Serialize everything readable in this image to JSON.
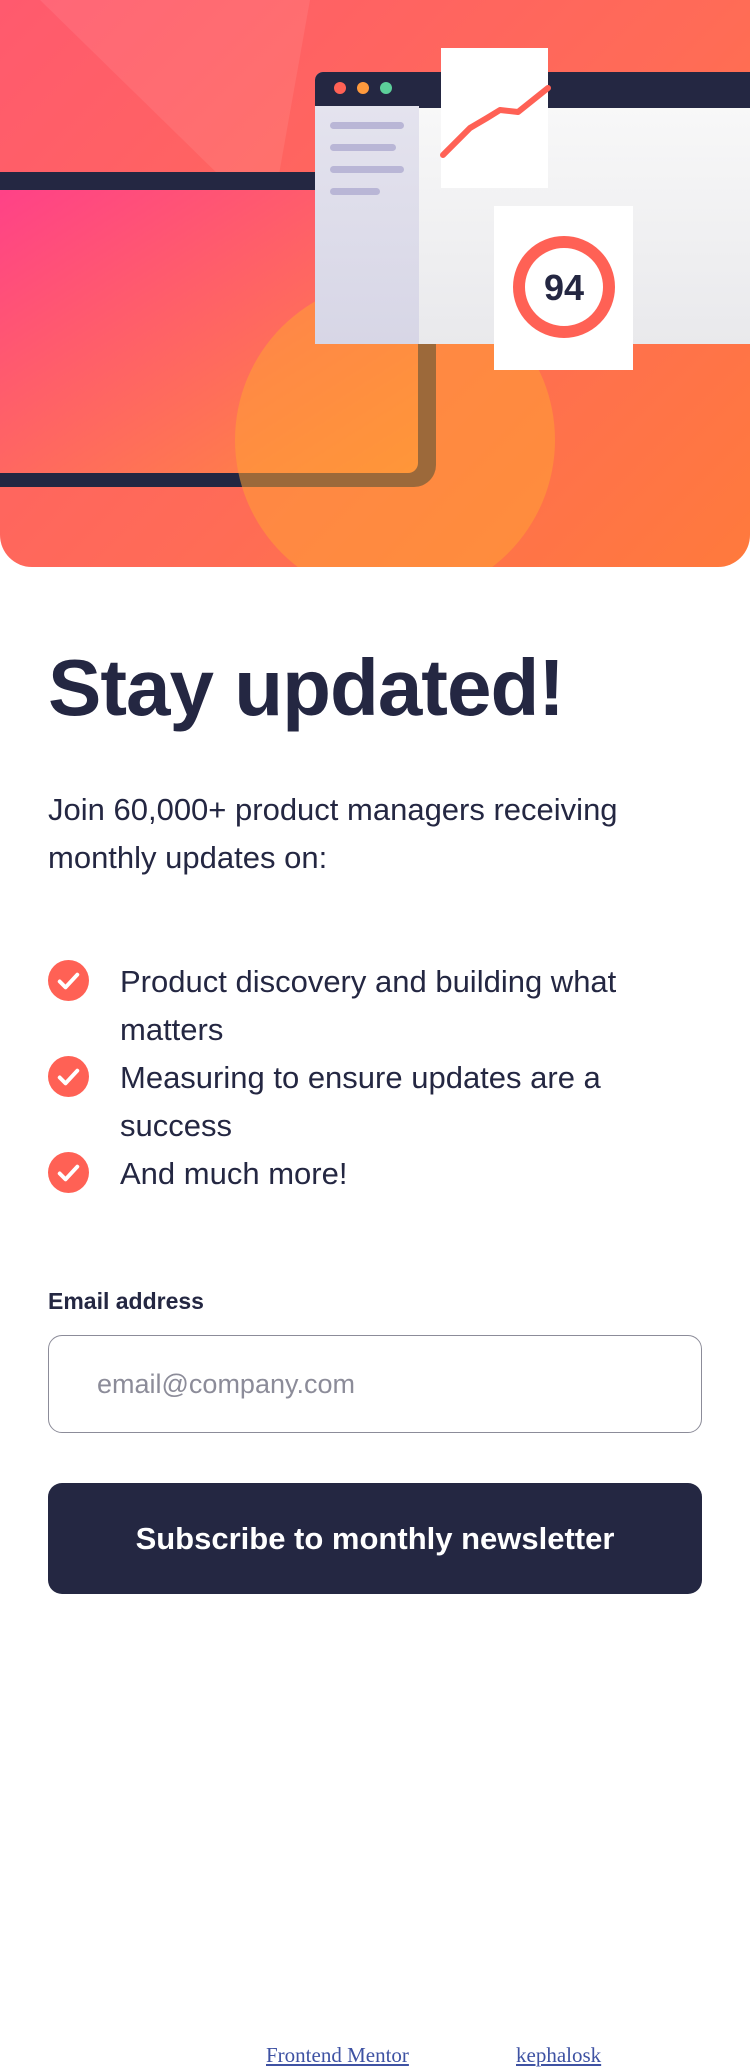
{
  "hero": {
    "score": "94"
  },
  "signup": {
    "title": "Stay updated!",
    "intro": "Join 60,000+ product managers receiving monthly updates on:",
    "features": [
      "Product discovery and building what matters",
      "Measuring to ensure updates are a success",
      "And much more!"
    ],
    "email_label": "Email address",
    "email_placeholder": "email@company.com",
    "email_value": "",
    "submit_label": "Subscribe to monthly newsletter"
  },
  "attribution": {
    "link1": "Frontend Mentor",
    "link2": "kephalosk"
  },
  "colors": {
    "dark_navy": "#242742",
    "tomato": "#ff6155",
    "grey": "#8c8c99",
    "white": "#ffffff"
  },
  "icons": {
    "feature_bullet": "check-circle-icon"
  }
}
